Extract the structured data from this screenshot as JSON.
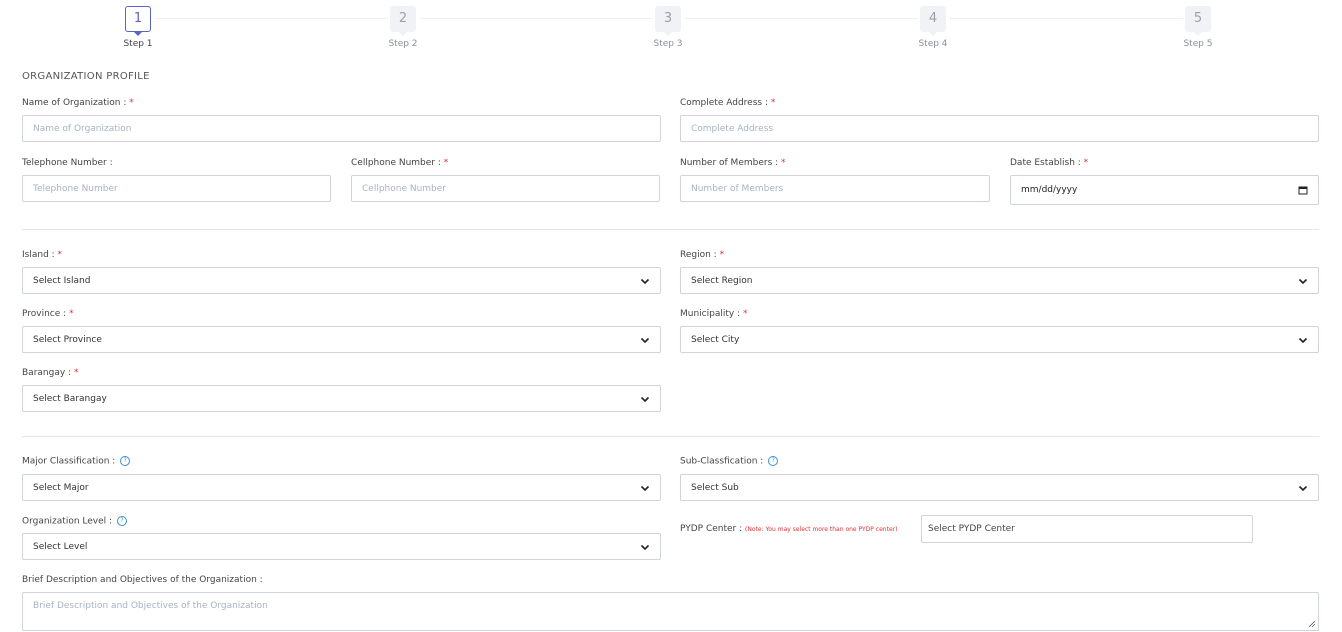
{
  "stepper": {
    "steps": [
      {
        "num": "1",
        "label": "Step 1",
        "active": true
      },
      {
        "num": "2",
        "label": "Step 2",
        "active": false
      },
      {
        "num": "3",
        "label": "Step 3",
        "active": false
      },
      {
        "num": "4",
        "label": "Step 4",
        "active": false
      },
      {
        "num": "5",
        "label": "Step 5",
        "active": false
      }
    ]
  },
  "form": {
    "section_title": "ORGANIZATION PROFILE",
    "required_mark": "*",
    "help_glyph": "?",
    "org_name": {
      "label": "Name of Organization :",
      "placeholder": "Name of Organization"
    },
    "address": {
      "label": "Complete Address :",
      "placeholder": "Complete Address"
    },
    "telephone": {
      "label": "Telephone Number :",
      "placeholder": "Telephone Number"
    },
    "cellphone": {
      "label": "Cellphone Number :",
      "placeholder": "Cellphone Number"
    },
    "members": {
      "label": "Number of Members :",
      "placeholder": "Number of Members"
    },
    "date": {
      "label": "Date Establish :",
      "value": "mm/dd/yyyy"
    },
    "island": {
      "label": "Island :",
      "value": "Select Island"
    },
    "region": {
      "label": "Region :",
      "value": "Select Region"
    },
    "province": {
      "label": "Province :",
      "value": "Select Province"
    },
    "municipality": {
      "label": "Municipality :",
      "value": "Select City"
    },
    "barangay": {
      "label": "Barangay :",
      "value": "Select Barangay"
    },
    "major": {
      "label": "Major Classification :",
      "value": "Select Major"
    },
    "sub": {
      "label": "Sub-Classfication :",
      "value": "Select Sub"
    },
    "level": {
      "label": "Organization Level :",
      "value": "Select Level"
    },
    "pydp": {
      "label": "PYDP Center :",
      "note": "(Note: You may select more than one PYDP center)",
      "value": "Select PYDP Center"
    },
    "description": {
      "label": "Brief Description and Objectives of the Organization :",
      "placeholder": "Brief Description and Objectives of the Organization"
    }
  },
  "colors": {
    "accent": "#5a63c7",
    "required": "#e03131",
    "help": "#3a8fd6"
  }
}
